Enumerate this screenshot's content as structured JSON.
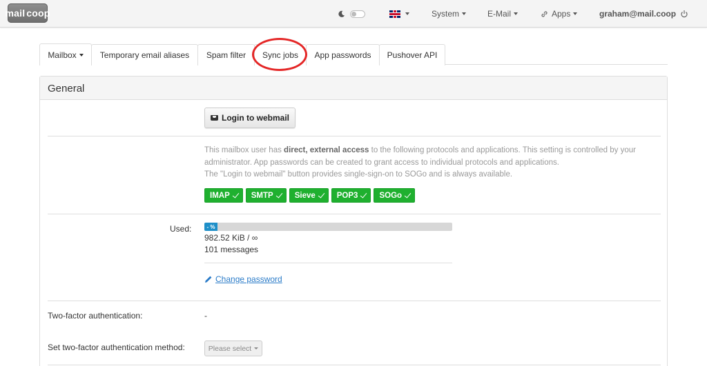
{
  "navbar": {
    "logo_left": "mail",
    "logo_right": "coop",
    "system": "System",
    "email": "E-Mail",
    "apps": "Apps",
    "user": "graham@mail.coop"
  },
  "tabs": [
    {
      "label": "Mailbox"
    },
    {
      "label": "Temporary email aliases"
    },
    {
      "label": "Spam filter"
    },
    {
      "label": "Sync jobs"
    },
    {
      "label": "App passwords"
    },
    {
      "label": "Pushover API"
    }
  ],
  "panel": {
    "heading": "General",
    "webmail_button": "Login to webmail",
    "info_pre": "This mailbox user has ",
    "info_bold": "direct, external access",
    "info_post": " to the following protocols and applications. This setting is controlled by your administrator. App passwords can be created to grant access to individual protocols and applications.",
    "info_line2": "The \"Login to webmail\" button provides single-sign-on to SOGo and is always available.",
    "protocols": [
      "IMAP",
      "SMTP",
      "Sieve",
      "POP3",
      "SOGo"
    ],
    "used_label": "Used:",
    "progress_text": "- %",
    "quota": "982.52 KiB / ∞",
    "messages": "101 messages",
    "change_password": "Change password",
    "tfa_label": "Two-factor authentication:",
    "tfa_value": "-",
    "set_tfa_label": "Set two-factor authentication method:",
    "select_placeholder": "Please select"
  },
  "colors": {
    "accent": "#2a7bc8",
    "protocol_badge": "#1fb02f",
    "highlight_circle": "#e42626",
    "progress": "#1e8fc8"
  }
}
